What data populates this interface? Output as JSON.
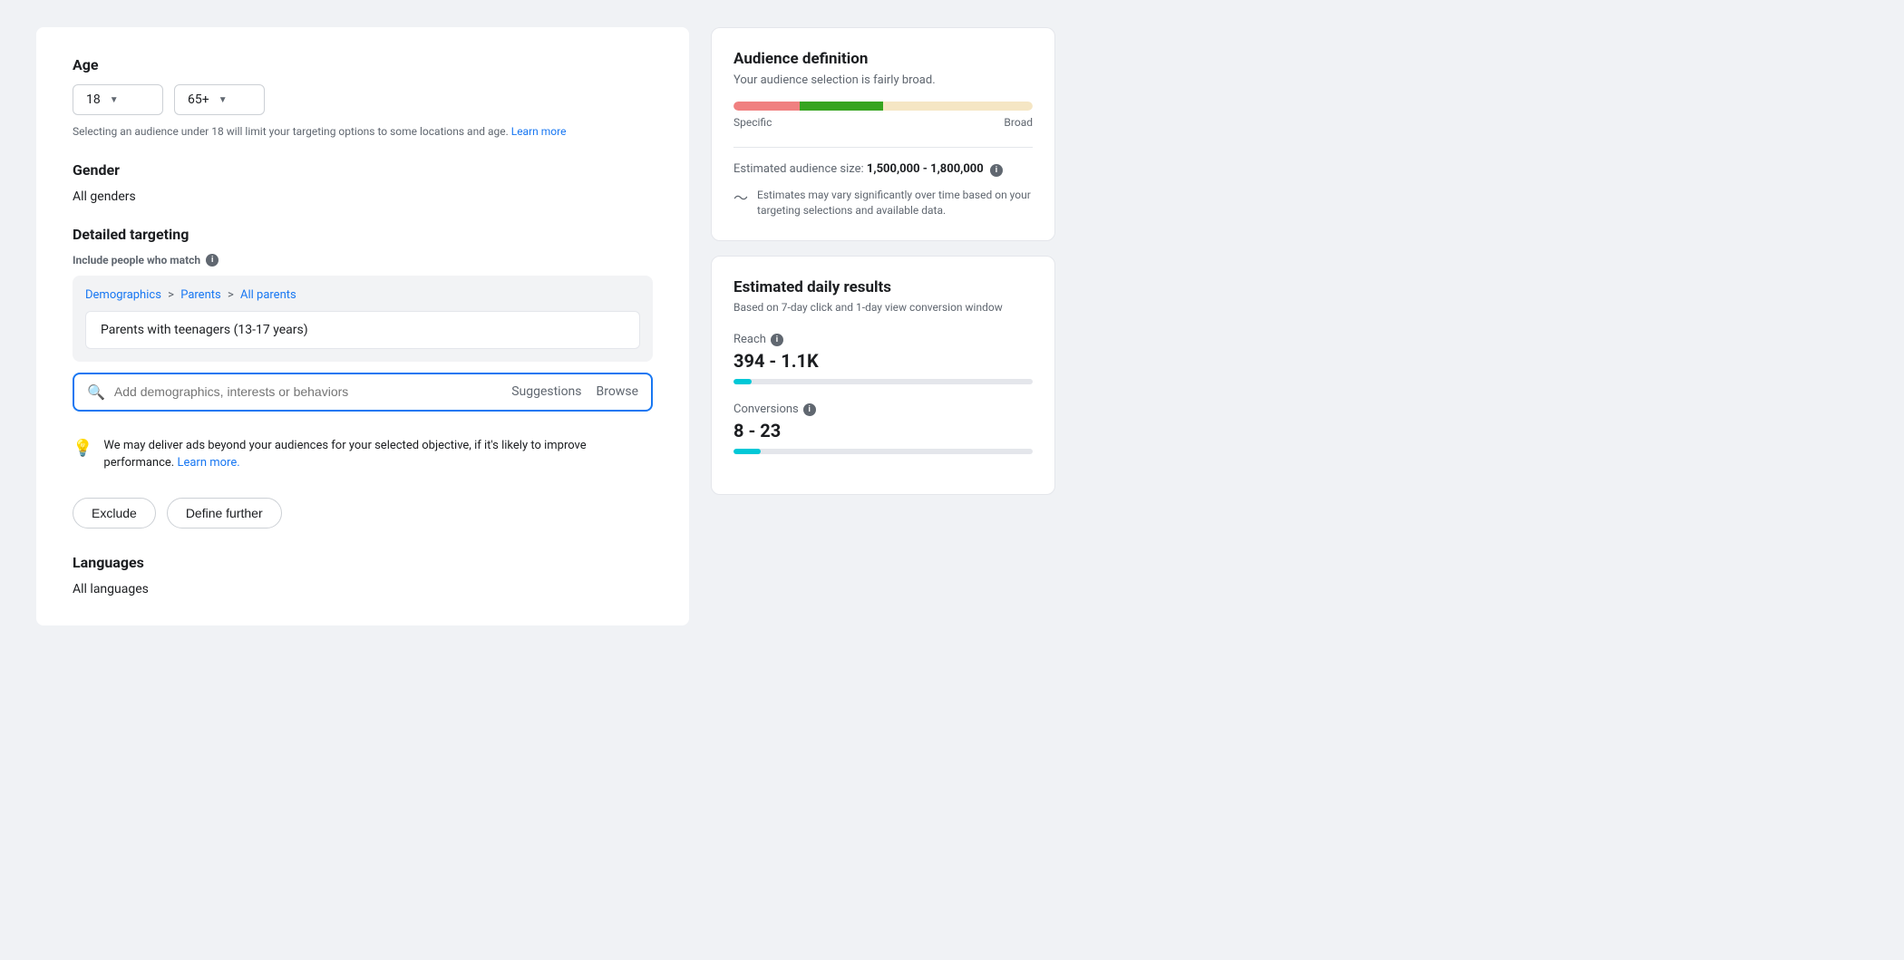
{
  "left": {
    "age_title": "Age",
    "age_min": "18",
    "age_max": "65+",
    "age_notice": "Selecting an audience under 18 will limit your targeting options to some locations and age.",
    "age_notice_link": "Learn more",
    "gender_title": "Gender",
    "gender_value": "All genders",
    "detailed_targeting_title": "Detailed targeting",
    "include_label": "Include people who match",
    "breadcrumb_part1": "Demographics",
    "breadcrumb_sep1": ">",
    "breadcrumb_part2": "Parents",
    "breadcrumb_sep2": ">",
    "breadcrumb_part3": "All parents",
    "target_item": "Parents with teenagers (13-17 years)",
    "search_placeholder": "Add demographics, interests or behaviors",
    "search_suggestions": "Suggestions",
    "search_browse": "Browse",
    "notice_text": "We may deliver ads beyond your audiences for your selected objective, if it's likely to improve performance.",
    "notice_link": "Learn more.",
    "exclude_btn": "Exclude",
    "define_further_btn": "Define further",
    "languages_title": "Languages",
    "languages_value": "All languages"
  },
  "audience_definition": {
    "title": "Audience definition",
    "subtitle": "Your audience selection is fairly broad.",
    "meter_specific_label": "Specific",
    "meter_broad_label": "Broad",
    "size_label": "Estimated audience size:",
    "size_value": "1,500,000 - 1,800,000",
    "estimates_note": "Estimates may vary significantly over time based on your targeting selections and available data."
  },
  "daily_results": {
    "title": "Estimated daily results",
    "subtitle": "Based on 7-day click and 1-day view conversion window",
    "reach_label": "Reach",
    "reach_value": "394 - 1.1K",
    "reach_bar_pct": "6",
    "conversions_label": "Conversions",
    "conversions_value": "8 - 23",
    "conversions_bar_pct": "9"
  },
  "icons": {
    "search": "🔍",
    "bulb": "💡",
    "info": "i",
    "graph": "〜"
  }
}
